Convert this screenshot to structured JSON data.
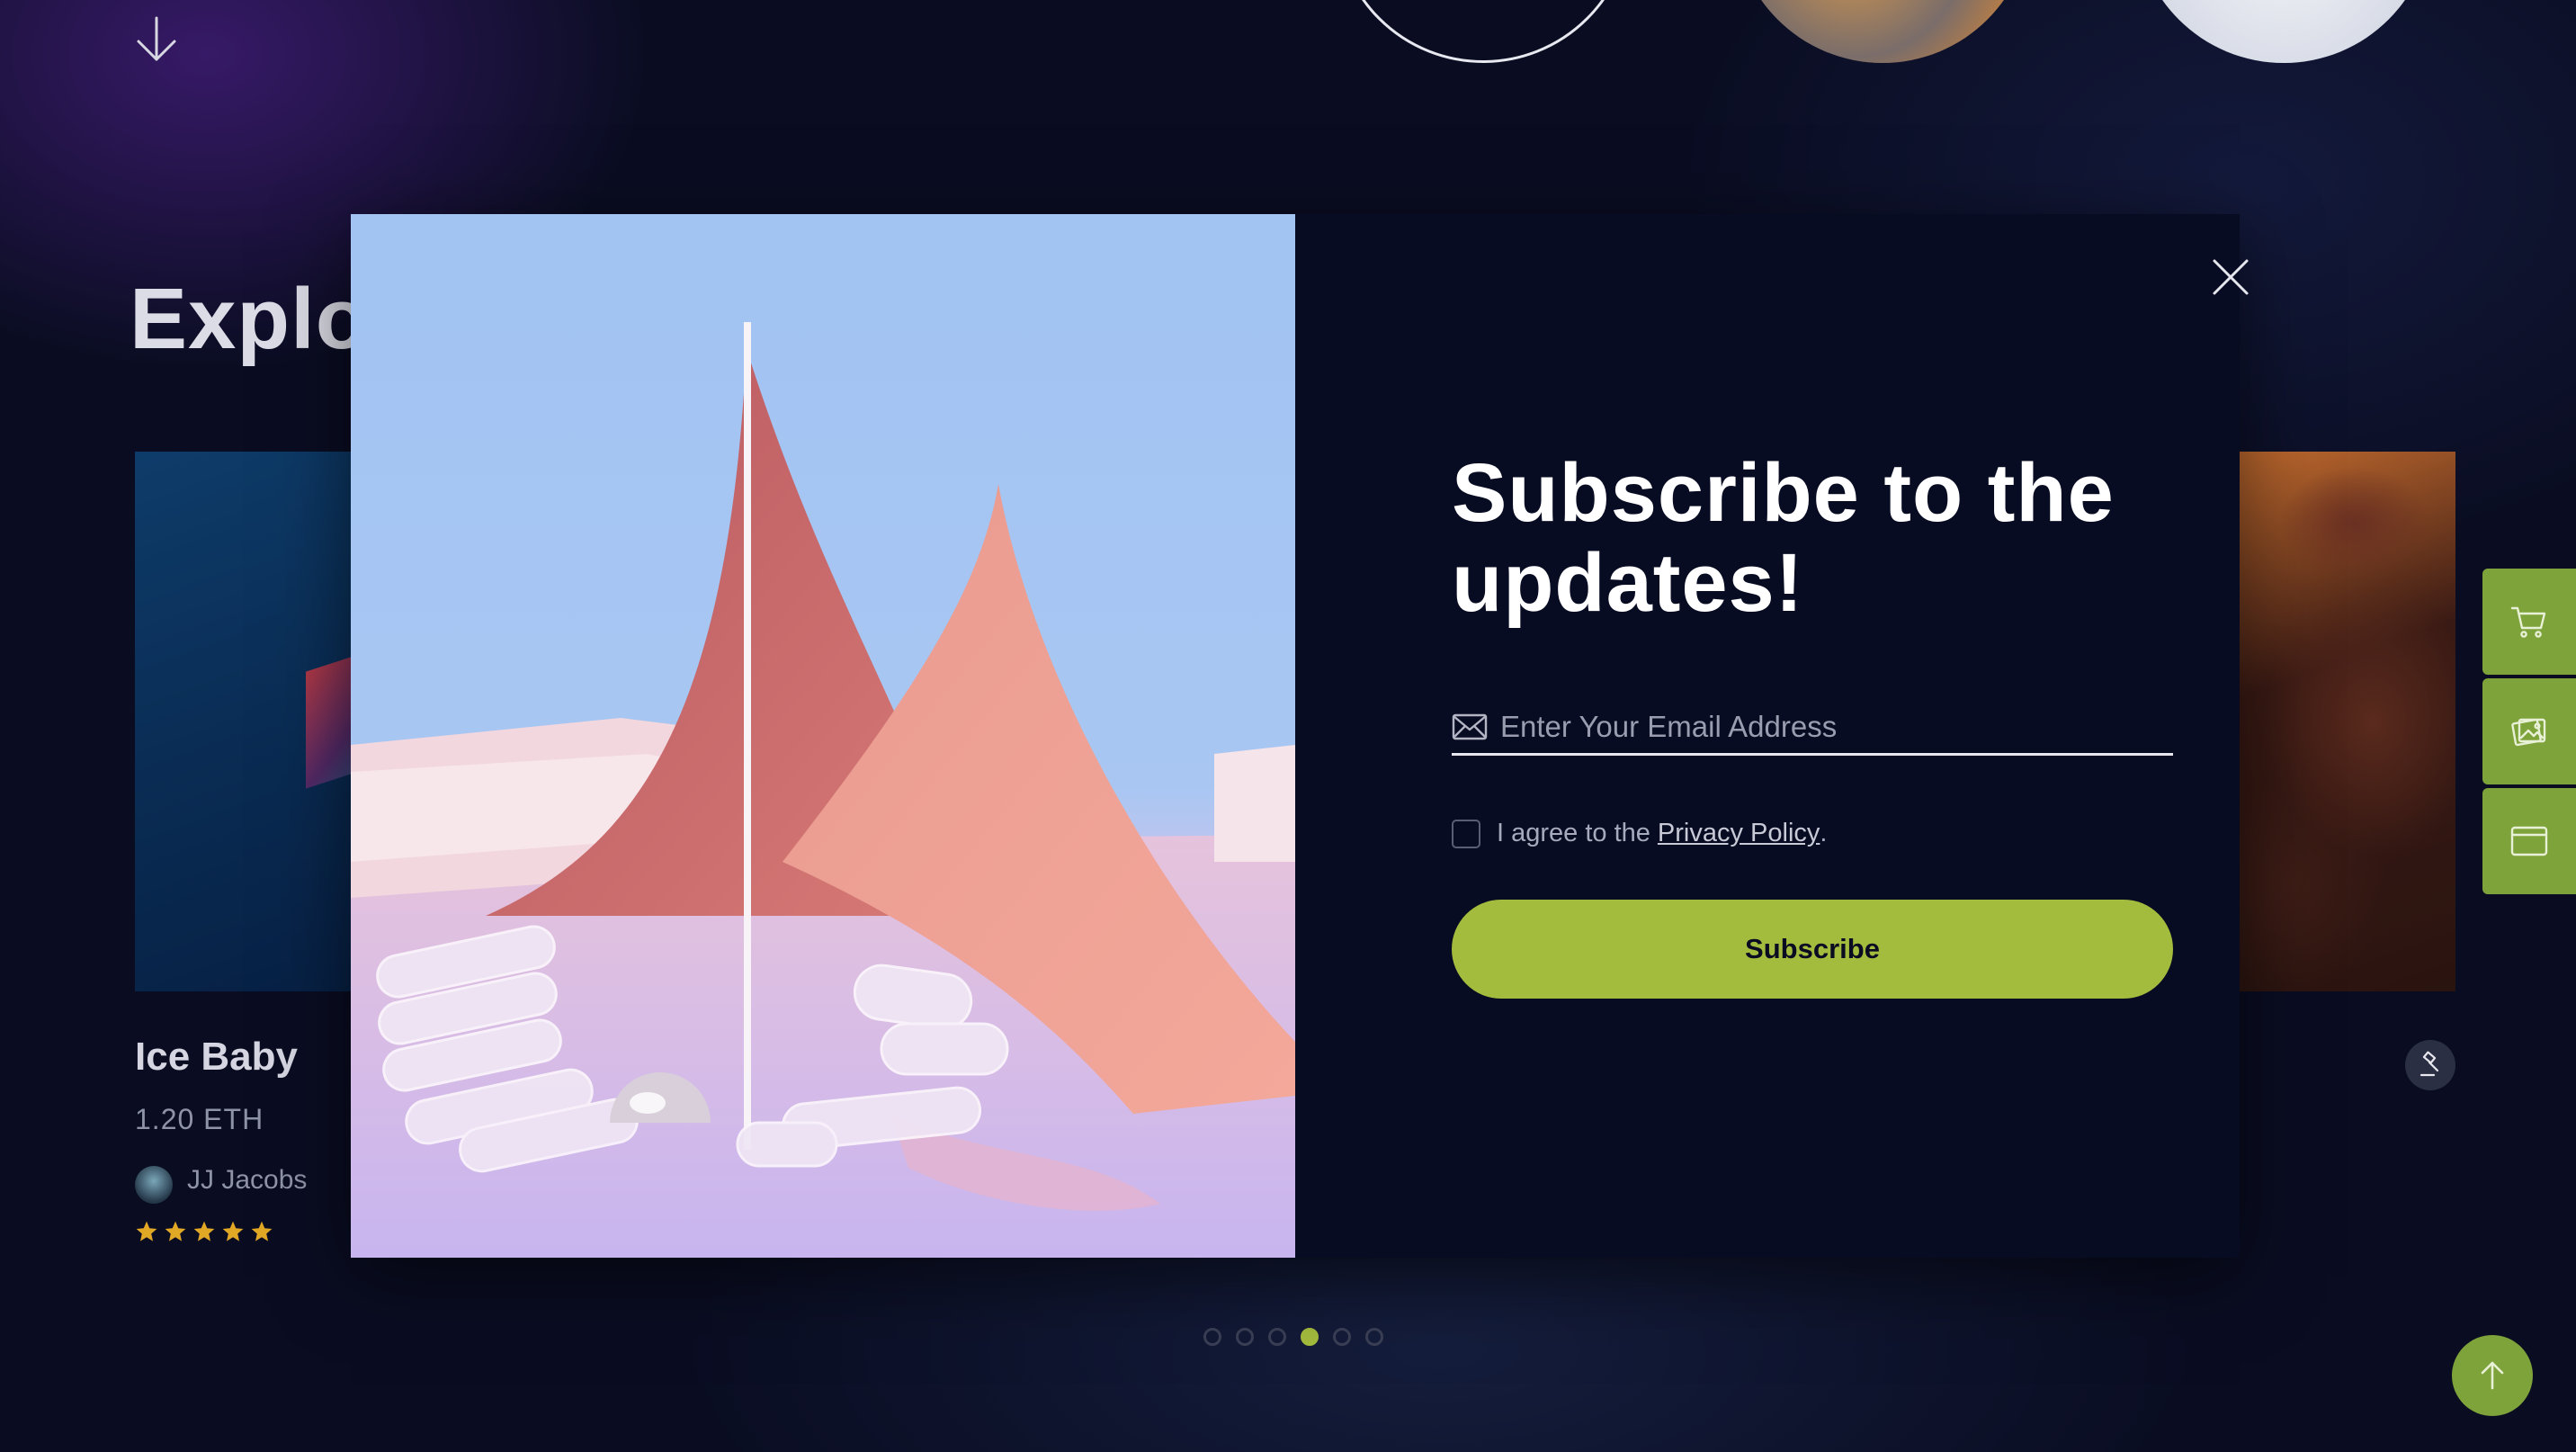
{
  "background": {
    "section_title": "Explor",
    "card": {
      "name": "Ice Baby",
      "price": "1.20 ETH",
      "author": "JJ Jacobs",
      "rating": 5
    },
    "pagination": {
      "total": 6,
      "active_index": 3
    },
    "side_tools": [
      "cart-icon",
      "image-gallery-icon",
      "browser-window-icon"
    ],
    "accent_color": "#a4bc3e"
  },
  "modal": {
    "title": "Subscribe to the updates!",
    "email": {
      "placeholder": "Enter Your Email Address",
      "value": ""
    },
    "agree": {
      "text": "I agree to the",
      "link": "Privacy Policy",
      "suffix": "."
    },
    "subscribe_label": "Subscribe",
    "close_icon": "close-icon"
  }
}
